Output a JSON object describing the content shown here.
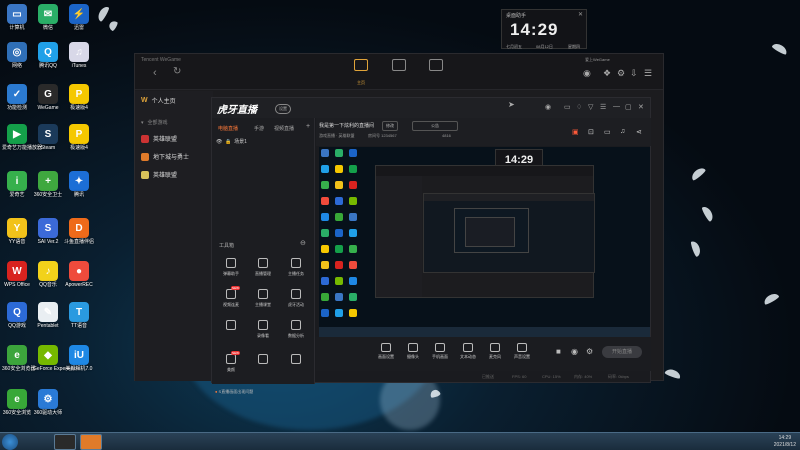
{
  "desktop": {
    "icons": [
      {
        "label": "计算机",
        "color": "#3a76c4",
        "glyph": "▭"
      },
      {
        "label": "微信",
        "color": "#2aae67",
        "glyph": "✉"
      },
      {
        "label": "迅雷",
        "color": "#1b64c7",
        "glyph": "⚡"
      },
      {
        "label": "网络",
        "color": "#2f6fb7",
        "glyph": "◎"
      },
      {
        "label": "腾讯QQ",
        "color": "#20a0e8",
        "glyph": "Q"
      },
      {
        "label": "iTunes",
        "color": "#d8d8e8",
        "glyph": "♫"
      },
      {
        "label": "功能检测",
        "color": "#2b7ad0",
        "glyph": "✓"
      },
      {
        "label": "WeGame",
        "color": "#2a2a2a",
        "glyph": "G"
      },
      {
        "label": "极速版4",
        "color": "#f5c800",
        "glyph": "P"
      },
      {
        "label": "爱奇艺万能播放器",
        "color": "#14a04a",
        "glyph": "▶"
      },
      {
        "label": "Steam",
        "color": "#1b3a5a",
        "glyph": "S"
      },
      {
        "label": "极速版4",
        "color": "#f5c800",
        "glyph": "P"
      },
      {
        "label": "爱奇艺",
        "color": "#36b04c",
        "glyph": "i"
      },
      {
        "label": "360安全卫士",
        "color": "#3fa83f",
        "glyph": "+"
      },
      {
        "label": "腾讯",
        "color": "#1c6ed6",
        "glyph": "✦"
      },
      {
        "label": "YY语音",
        "color": "#f2c21a",
        "glyph": "Y"
      },
      {
        "label": "SAI Ver.2",
        "color": "#3b6ad8",
        "glyph": "S"
      },
      {
        "label": "斗鱼直播伴侣",
        "color": "#ee6a1a",
        "glyph": "D"
      },
      {
        "label": "WPS Office",
        "color": "#d8231f",
        "glyph": "W"
      },
      {
        "label": "QQ音乐",
        "color": "#f2d21a",
        "glyph": "♪"
      },
      {
        "label": "ApowerREC",
        "color": "#ef4b3c",
        "glyph": "●"
      },
      {
        "label": "QQ游戏",
        "color": "#2c6ad6",
        "glyph": "Q"
      },
      {
        "label": "Pentablet",
        "color": "#e9eef2",
        "glyph": "✎"
      },
      {
        "label": "TT语音",
        "color": "#2a9ae0",
        "glyph": "T"
      },
      {
        "label": "360安全浏览器",
        "color": "#3ca53c",
        "glyph": "e"
      },
      {
        "label": "GeForce Experience",
        "color": "#76b900",
        "glyph": "◆"
      },
      {
        "label": "美颜相机7.0",
        "color": "#1e88e5",
        "glyph": "iU"
      },
      {
        "label": "360安全浏览",
        "color": "#38a838",
        "glyph": "e"
      },
      {
        "label": "360驱动大师",
        "color": "#2a7ad6",
        "glyph": "⚙"
      }
    ]
  },
  "clock": {
    "title": "桌面助手",
    "close": "✕",
    "time": "14:29",
    "weekday": "七月初五",
    "date": "08月12日",
    "day": "星期四"
  },
  "wegame": {
    "brand": "Tencent WeGame",
    "back": "‹",
    "refresh": "↻",
    "home_label": "主页",
    "user_label": "爱上WeGame",
    "sidebar": {
      "personal": "个人主页",
      "section": "全部游戏",
      "items": [
        {
          "label": "英雄联盟",
          "color": "#c33"
        },
        {
          "label": "地下城与勇士",
          "color": "#e07b2a"
        },
        {
          "label": "英雄联盟",
          "color": "#d8c25a"
        }
      ]
    }
  },
  "huya": {
    "logo": "虎牙直播",
    "badge": "设置",
    "tabs": [
      "电脑直播",
      "手游",
      "视频直播"
    ],
    "scene": "场景1",
    "tools_header": "工具箱",
    "tools": [
      {
        "label": "弹幕助手",
        "new": false
      },
      {
        "label": "直播管理",
        "new": false
      },
      {
        "label": "主播任务",
        "new": false
      },
      {
        "label": "视频连麦",
        "new": true
      },
      {
        "label": "主播课堂",
        "new": false
      },
      {
        "label": "虎牙活动",
        "new": false
      },
      {
        "label": "",
        "new": false
      },
      {
        "label": "录像看",
        "new": false
      },
      {
        "label": "数据分析",
        "new": false
      },
      {
        "label": "美颜",
        "new": true
      },
      {
        "label": "",
        "new": false
      },
      {
        "label": "",
        "new": false
      }
    ],
    "notice": "S直播画面出现问题",
    "room": {
      "name": "我是第一下炫利的直播间",
      "pill1": "修改",
      "pill2": "公告",
      "sub_left": "游戏直播 · 英雄联盟",
      "sub_mid": "房间号 1234567",
      "sub_right": "4816"
    },
    "controls": [
      "画面设置",
      "摄像头",
      "手机画面",
      "文本动态",
      "麦克风",
      "声音设置"
    ],
    "start_live": "开始直播",
    "status_left": "已推送",
    "status_items": [
      "FPS: 60",
      "CPU: 15%",
      "内存: 40%",
      "码率: 0kbps"
    ]
  },
  "taskbar": {
    "time": "14:29",
    "date": "2021/8/12"
  }
}
